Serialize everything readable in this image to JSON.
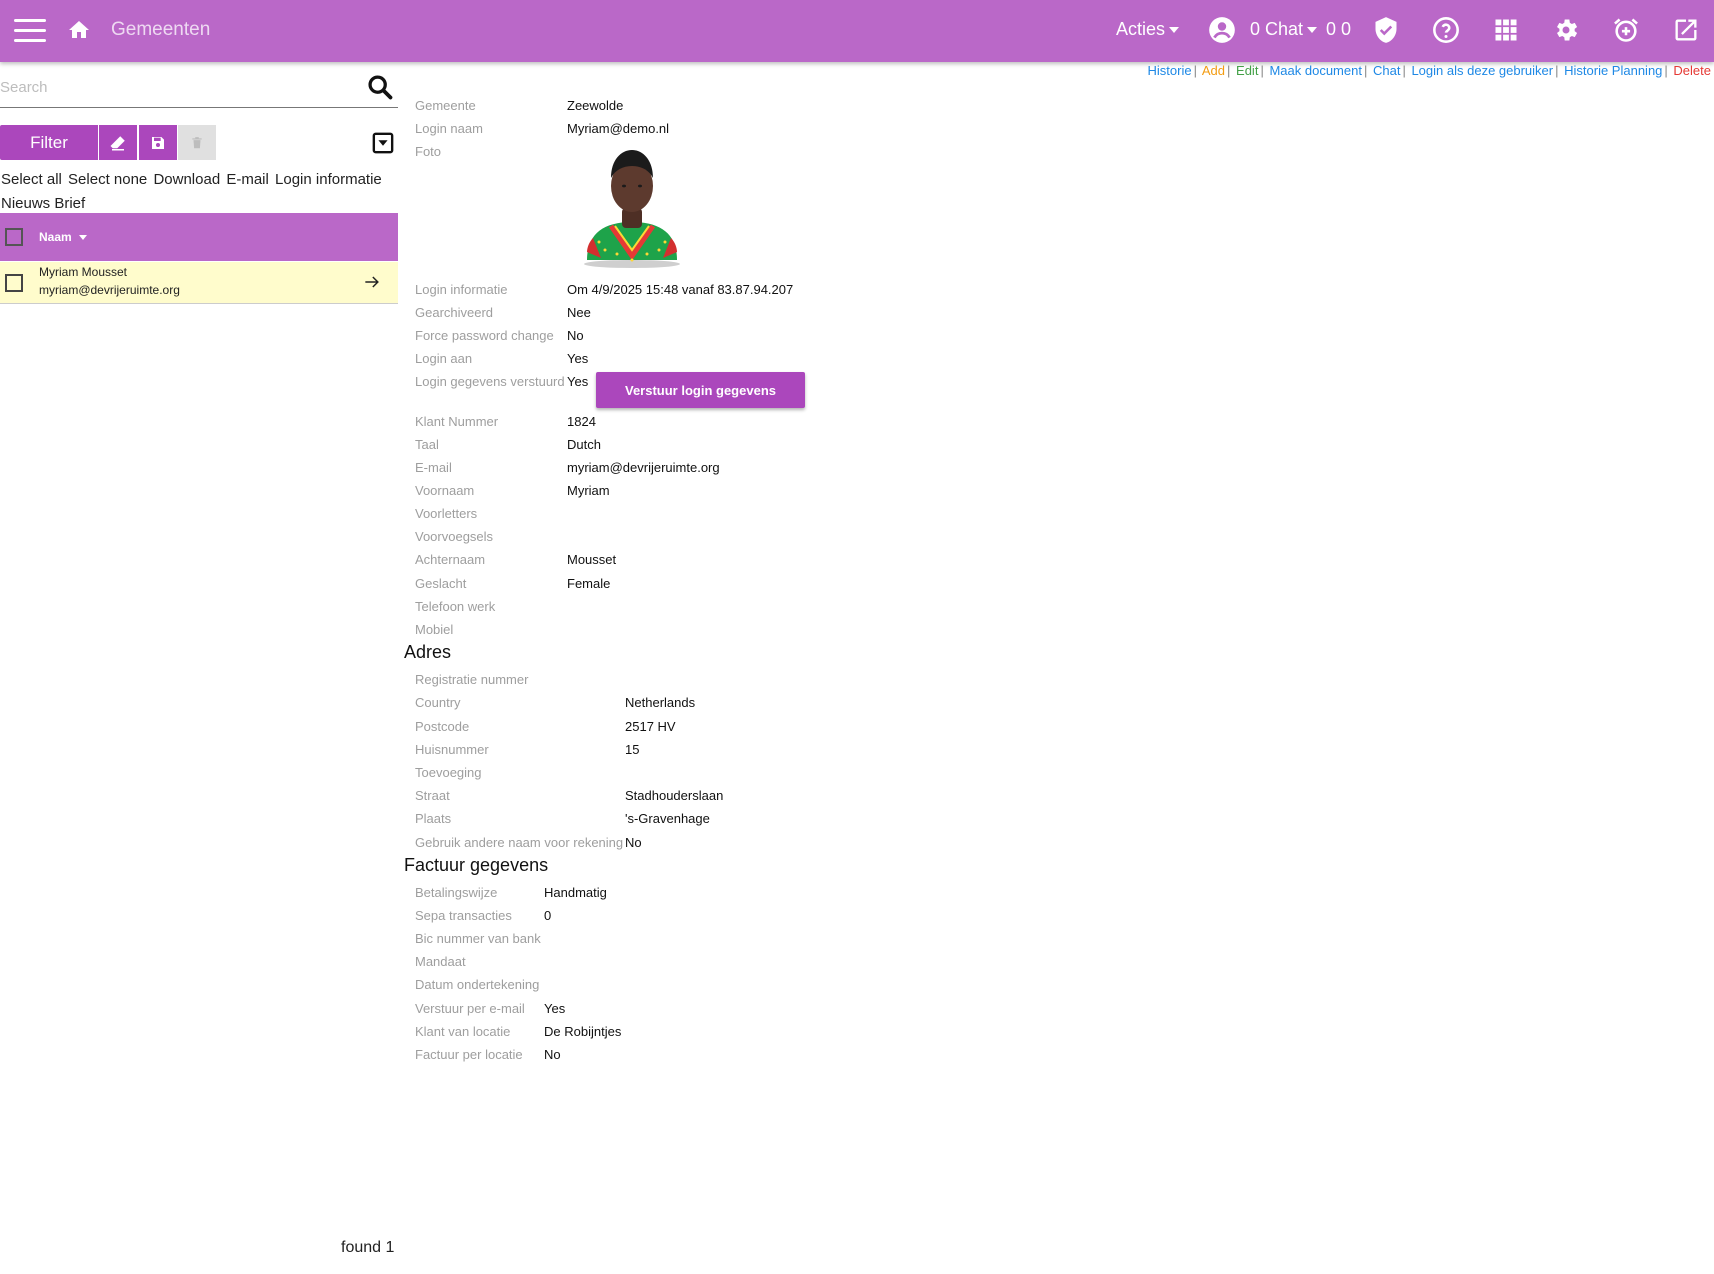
{
  "topbar": {
    "title": "Gemeenten",
    "acties_label": "Acties",
    "chat_label": "0 Chat",
    "counts": "0 0",
    "icons": [
      "menu-icon",
      "home-icon",
      "account-circle-icon",
      "shield-check-icon",
      "help-circle-icon",
      "apps-grid-icon",
      "gear-icon",
      "alarm-add-icon",
      "open-external-icon"
    ]
  },
  "sidebar": {
    "search_placeholder": "Search",
    "filter_label": "Filter",
    "actions": [
      "Select all",
      "Select none",
      "Download",
      "E-mail",
      "Login informatie",
      "Nieuws Brief"
    ],
    "column_naam": "Naam",
    "rows": [
      {
        "name": "Myriam Mousset",
        "email": "myriam@devrijeruimte.org"
      }
    ],
    "found_text": "found 1"
  },
  "links": [
    {
      "label": "Historie",
      "color": "#1e88e5"
    },
    {
      "label": "Add",
      "color": "#f39c12"
    },
    {
      "label": "Edit",
      "color": "#43a047"
    },
    {
      "label": "Maak document",
      "color": "#1e88e5"
    },
    {
      "label": "Chat",
      "color": "#1e88e5"
    },
    {
      "label": "Login als deze gebruiker",
      "color": "#1e88e5"
    },
    {
      "label": "Historie Planning",
      "color": "#1e88e5"
    },
    {
      "label": "Delete",
      "color": "#e53935"
    }
  ],
  "details": {
    "gemeente": {
      "label": "Gemeente",
      "value": "Zeewolde"
    },
    "login_naam": {
      "label": "Login naam",
      "value": "Myriam@demo.nl"
    },
    "foto": {
      "label": "Foto"
    },
    "login_informatie": {
      "label": "Login informatie",
      "value": "Om 4/9/2025 15:48 vanaf 83.87.94.207"
    },
    "gearchiveerd": {
      "label": "Gearchiveerd",
      "value": "Nee"
    },
    "force_pw": {
      "label": "Force password change",
      "value": "No"
    },
    "login_aan": {
      "label": "Login aan",
      "value": "Yes"
    },
    "login_verstuurd": {
      "label": "Login gegevens verstuurd",
      "value": "Yes"
    },
    "send_button": "Verstuur login gegevens",
    "klant_nummer": {
      "label": "Klant Nummer",
      "value": "1824"
    },
    "taal": {
      "label": "Taal",
      "value": "Dutch"
    },
    "email": {
      "label": "E-mail",
      "value": "myriam@devrijeruimte.org"
    },
    "voornaam": {
      "label": "Voornaam",
      "value": "Myriam"
    },
    "voorletters": {
      "label": "Voorletters",
      "value": ""
    },
    "voorvoegsels": {
      "label": "Voorvoegsels",
      "value": ""
    },
    "achternaam": {
      "label": "Achternaam",
      "value": "Mousset"
    },
    "geslacht": {
      "label": "Geslacht",
      "value": "Female"
    },
    "telefoon": {
      "label": "Telefoon werk",
      "value": ""
    },
    "mobiel": {
      "label": "Mobiel",
      "value": ""
    }
  },
  "adres": {
    "title": "Adres",
    "registratie": {
      "label": "Registratie nummer",
      "value": ""
    },
    "country": {
      "label": "Country",
      "value": "Netherlands"
    },
    "postcode": {
      "label": "Postcode",
      "value": "2517 HV"
    },
    "huisnummer": {
      "label": "Huisnummer",
      "value": "15"
    },
    "toevoeging": {
      "label": "Toevoeging",
      "value": ""
    },
    "straat": {
      "label": "Straat",
      "value": "Stadhouderslaan"
    },
    "plaats": {
      "label": "Plaats",
      "value": "'s-Gravenhage"
    },
    "andere_naam": {
      "label": "Gebruik andere naam voor rekening",
      "value": "No"
    }
  },
  "factuur": {
    "title": "Factuur gegevens",
    "betalingswijze": {
      "label": "Betalingswijze",
      "value": "Handmatig"
    },
    "sepa": {
      "label": "Sepa transacties",
      "value": "0"
    },
    "bic": {
      "label": "Bic nummer van bank",
      "value": ""
    },
    "mandaat": {
      "label": "Mandaat",
      "value": ""
    },
    "datum": {
      "label": "Datum ondertekening",
      "value": ""
    },
    "per_email": {
      "label": "Verstuur per e-mail",
      "value": "Yes"
    },
    "klant_locatie": {
      "label": "Klant van locatie",
      "value": "De Robijntjes"
    },
    "per_locatie": {
      "label": "Factuur per locatie",
      "value": "No"
    }
  },
  "colors": {
    "primary": "#ba68c8",
    "button": "#ab47bc",
    "row_highlight": "#fffccc"
  }
}
